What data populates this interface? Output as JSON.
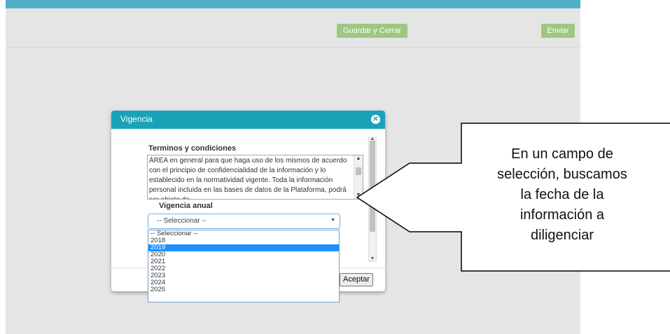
{
  "toolbar": {
    "save_close_label": "Guardar y Cerrar",
    "send_label": "Enviar"
  },
  "modal": {
    "title": "Vigencia",
    "close_icon": "close-icon",
    "terms_heading": "Terminos y condiciones",
    "terms_text": "ÁREA en general para que haga uso de los mismos de acuerdo con el principio de confidencialidad de la información y lo establecido en la normatividad vigente. Toda la información personal incluida en las bases de datos de la Plataforma, podrá ser objeto de",
    "year_label": "Vigencia anual",
    "year_select_value": "-- Seleccionar --",
    "year_options": [
      "-- Seleccionar --",
      "2018",
      "2019",
      "2020",
      "2021",
      "2022",
      "2023",
      "2024",
      "2025"
    ],
    "year_highlighted": "2019",
    "accept_label": "Aceptar"
  },
  "callout": {
    "text": "En un campo de\nselección, buscamos\nla fecha de la\ninformación a\ndiligenciar"
  },
  "colors": {
    "top_bar": "#4fb0c6",
    "header": "#1aa2b6",
    "green_button": "#9dc783",
    "highlight": "#1e90ff"
  }
}
